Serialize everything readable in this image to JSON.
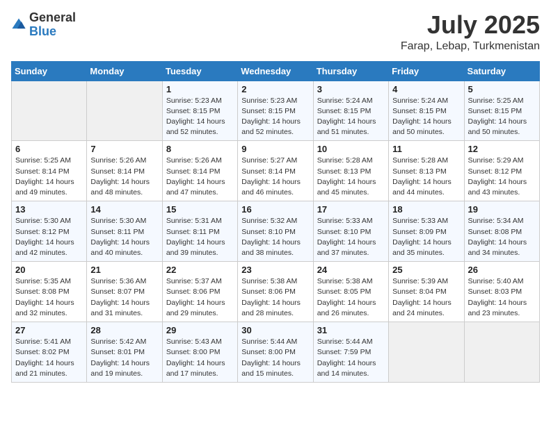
{
  "logo": {
    "general": "General",
    "blue": "Blue"
  },
  "title": "July 2025",
  "location": "Farap, Lebap, Turkmenistan",
  "days_of_week": [
    "Sunday",
    "Monday",
    "Tuesday",
    "Wednesday",
    "Thursday",
    "Friday",
    "Saturday"
  ],
  "weeks": [
    [
      {
        "num": "",
        "sunrise": "",
        "sunset": "",
        "daylight": ""
      },
      {
        "num": "",
        "sunrise": "",
        "sunset": "",
        "daylight": ""
      },
      {
        "num": "1",
        "sunrise": "Sunrise: 5:23 AM",
        "sunset": "Sunset: 8:15 PM",
        "daylight": "Daylight: 14 hours and 52 minutes."
      },
      {
        "num": "2",
        "sunrise": "Sunrise: 5:23 AM",
        "sunset": "Sunset: 8:15 PM",
        "daylight": "Daylight: 14 hours and 52 minutes."
      },
      {
        "num": "3",
        "sunrise": "Sunrise: 5:24 AM",
        "sunset": "Sunset: 8:15 PM",
        "daylight": "Daylight: 14 hours and 51 minutes."
      },
      {
        "num": "4",
        "sunrise": "Sunrise: 5:24 AM",
        "sunset": "Sunset: 8:15 PM",
        "daylight": "Daylight: 14 hours and 50 minutes."
      },
      {
        "num": "5",
        "sunrise": "Sunrise: 5:25 AM",
        "sunset": "Sunset: 8:15 PM",
        "daylight": "Daylight: 14 hours and 50 minutes."
      }
    ],
    [
      {
        "num": "6",
        "sunrise": "Sunrise: 5:25 AM",
        "sunset": "Sunset: 8:14 PM",
        "daylight": "Daylight: 14 hours and 49 minutes."
      },
      {
        "num": "7",
        "sunrise": "Sunrise: 5:26 AM",
        "sunset": "Sunset: 8:14 PM",
        "daylight": "Daylight: 14 hours and 48 minutes."
      },
      {
        "num": "8",
        "sunrise": "Sunrise: 5:26 AM",
        "sunset": "Sunset: 8:14 PM",
        "daylight": "Daylight: 14 hours and 47 minutes."
      },
      {
        "num": "9",
        "sunrise": "Sunrise: 5:27 AM",
        "sunset": "Sunset: 8:14 PM",
        "daylight": "Daylight: 14 hours and 46 minutes."
      },
      {
        "num": "10",
        "sunrise": "Sunrise: 5:28 AM",
        "sunset": "Sunset: 8:13 PM",
        "daylight": "Daylight: 14 hours and 45 minutes."
      },
      {
        "num": "11",
        "sunrise": "Sunrise: 5:28 AM",
        "sunset": "Sunset: 8:13 PM",
        "daylight": "Daylight: 14 hours and 44 minutes."
      },
      {
        "num": "12",
        "sunrise": "Sunrise: 5:29 AM",
        "sunset": "Sunset: 8:12 PM",
        "daylight": "Daylight: 14 hours and 43 minutes."
      }
    ],
    [
      {
        "num": "13",
        "sunrise": "Sunrise: 5:30 AM",
        "sunset": "Sunset: 8:12 PM",
        "daylight": "Daylight: 14 hours and 42 minutes."
      },
      {
        "num": "14",
        "sunrise": "Sunrise: 5:30 AM",
        "sunset": "Sunset: 8:11 PM",
        "daylight": "Daylight: 14 hours and 40 minutes."
      },
      {
        "num": "15",
        "sunrise": "Sunrise: 5:31 AM",
        "sunset": "Sunset: 8:11 PM",
        "daylight": "Daylight: 14 hours and 39 minutes."
      },
      {
        "num": "16",
        "sunrise": "Sunrise: 5:32 AM",
        "sunset": "Sunset: 8:10 PM",
        "daylight": "Daylight: 14 hours and 38 minutes."
      },
      {
        "num": "17",
        "sunrise": "Sunrise: 5:33 AM",
        "sunset": "Sunset: 8:10 PM",
        "daylight": "Daylight: 14 hours and 37 minutes."
      },
      {
        "num": "18",
        "sunrise": "Sunrise: 5:33 AM",
        "sunset": "Sunset: 8:09 PM",
        "daylight": "Daylight: 14 hours and 35 minutes."
      },
      {
        "num": "19",
        "sunrise": "Sunrise: 5:34 AM",
        "sunset": "Sunset: 8:08 PM",
        "daylight": "Daylight: 14 hours and 34 minutes."
      }
    ],
    [
      {
        "num": "20",
        "sunrise": "Sunrise: 5:35 AM",
        "sunset": "Sunset: 8:08 PM",
        "daylight": "Daylight: 14 hours and 32 minutes."
      },
      {
        "num": "21",
        "sunrise": "Sunrise: 5:36 AM",
        "sunset": "Sunset: 8:07 PM",
        "daylight": "Daylight: 14 hours and 31 minutes."
      },
      {
        "num": "22",
        "sunrise": "Sunrise: 5:37 AM",
        "sunset": "Sunset: 8:06 PM",
        "daylight": "Daylight: 14 hours and 29 minutes."
      },
      {
        "num": "23",
        "sunrise": "Sunrise: 5:38 AM",
        "sunset": "Sunset: 8:06 PM",
        "daylight": "Daylight: 14 hours and 28 minutes."
      },
      {
        "num": "24",
        "sunrise": "Sunrise: 5:38 AM",
        "sunset": "Sunset: 8:05 PM",
        "daylight": "Daylight: 14 hours and 26 minutes."
      },
      {
        "num": "25",
        "sunrise": "Sunrise: 5:39 AM",
        "sunset": "Sunset: 8:04 PM",
        "daylight": "Daylight: 14 hours and 24 minutes."
      },
      {
        "num": "26",
        "sunrise": "Sunrise: 5:40 AM",
        "sunset": "Sunset: 8:03 PM",
        "daylight": "Daylight: 14 hours and 23 minutes."
      }
    ],
    [
      {
        "num": "27",
        "sunrise": "Sunrise: 5:41 AM",
        "sunset": "Sunset: 8:02 PM",
        "daylight": "Daylight: 14 hours and 21 minutes."
      },
      {
        "num": "28",
        "sunrise": "Sunrise: 5:42 AM",
        "sunset": "Sunset: 8:01 PM",
        "daylight": "Daylight: 14 hours and 19 minutes."
      },
      {
        "num": "29",
        "sunrise": "Sunrise: 5:43 AM",
        "sunset": "Sunset: 8:00 PM",
        "daylight": "Daylight: 14 hours and 17 minutes."
      },
      {
        "num": "30",
        "sunrise": "Sunrise: 5:44 AM",
        "sunset": "Sunset: 8:00 PM",
        "daylight": "Daylight: 14 hours and 15 minutes."
      },
      {
        "num": "31",
        "sunrise": "Sunrise: 5:44 AM",
        "sunset": "Sunset: 7:59 PM",
        "daylight": "Daylight: 14 hours and 14 minutes."
      },
      {
        "num": "",
        "sunrise": "",
        "sunset": "",
        "daylight": ""
      },
      {
        "num": "",
        "sunrise": "",
        "sunset": "",
        "daylight": ""
      }
    ]
  ]
}
